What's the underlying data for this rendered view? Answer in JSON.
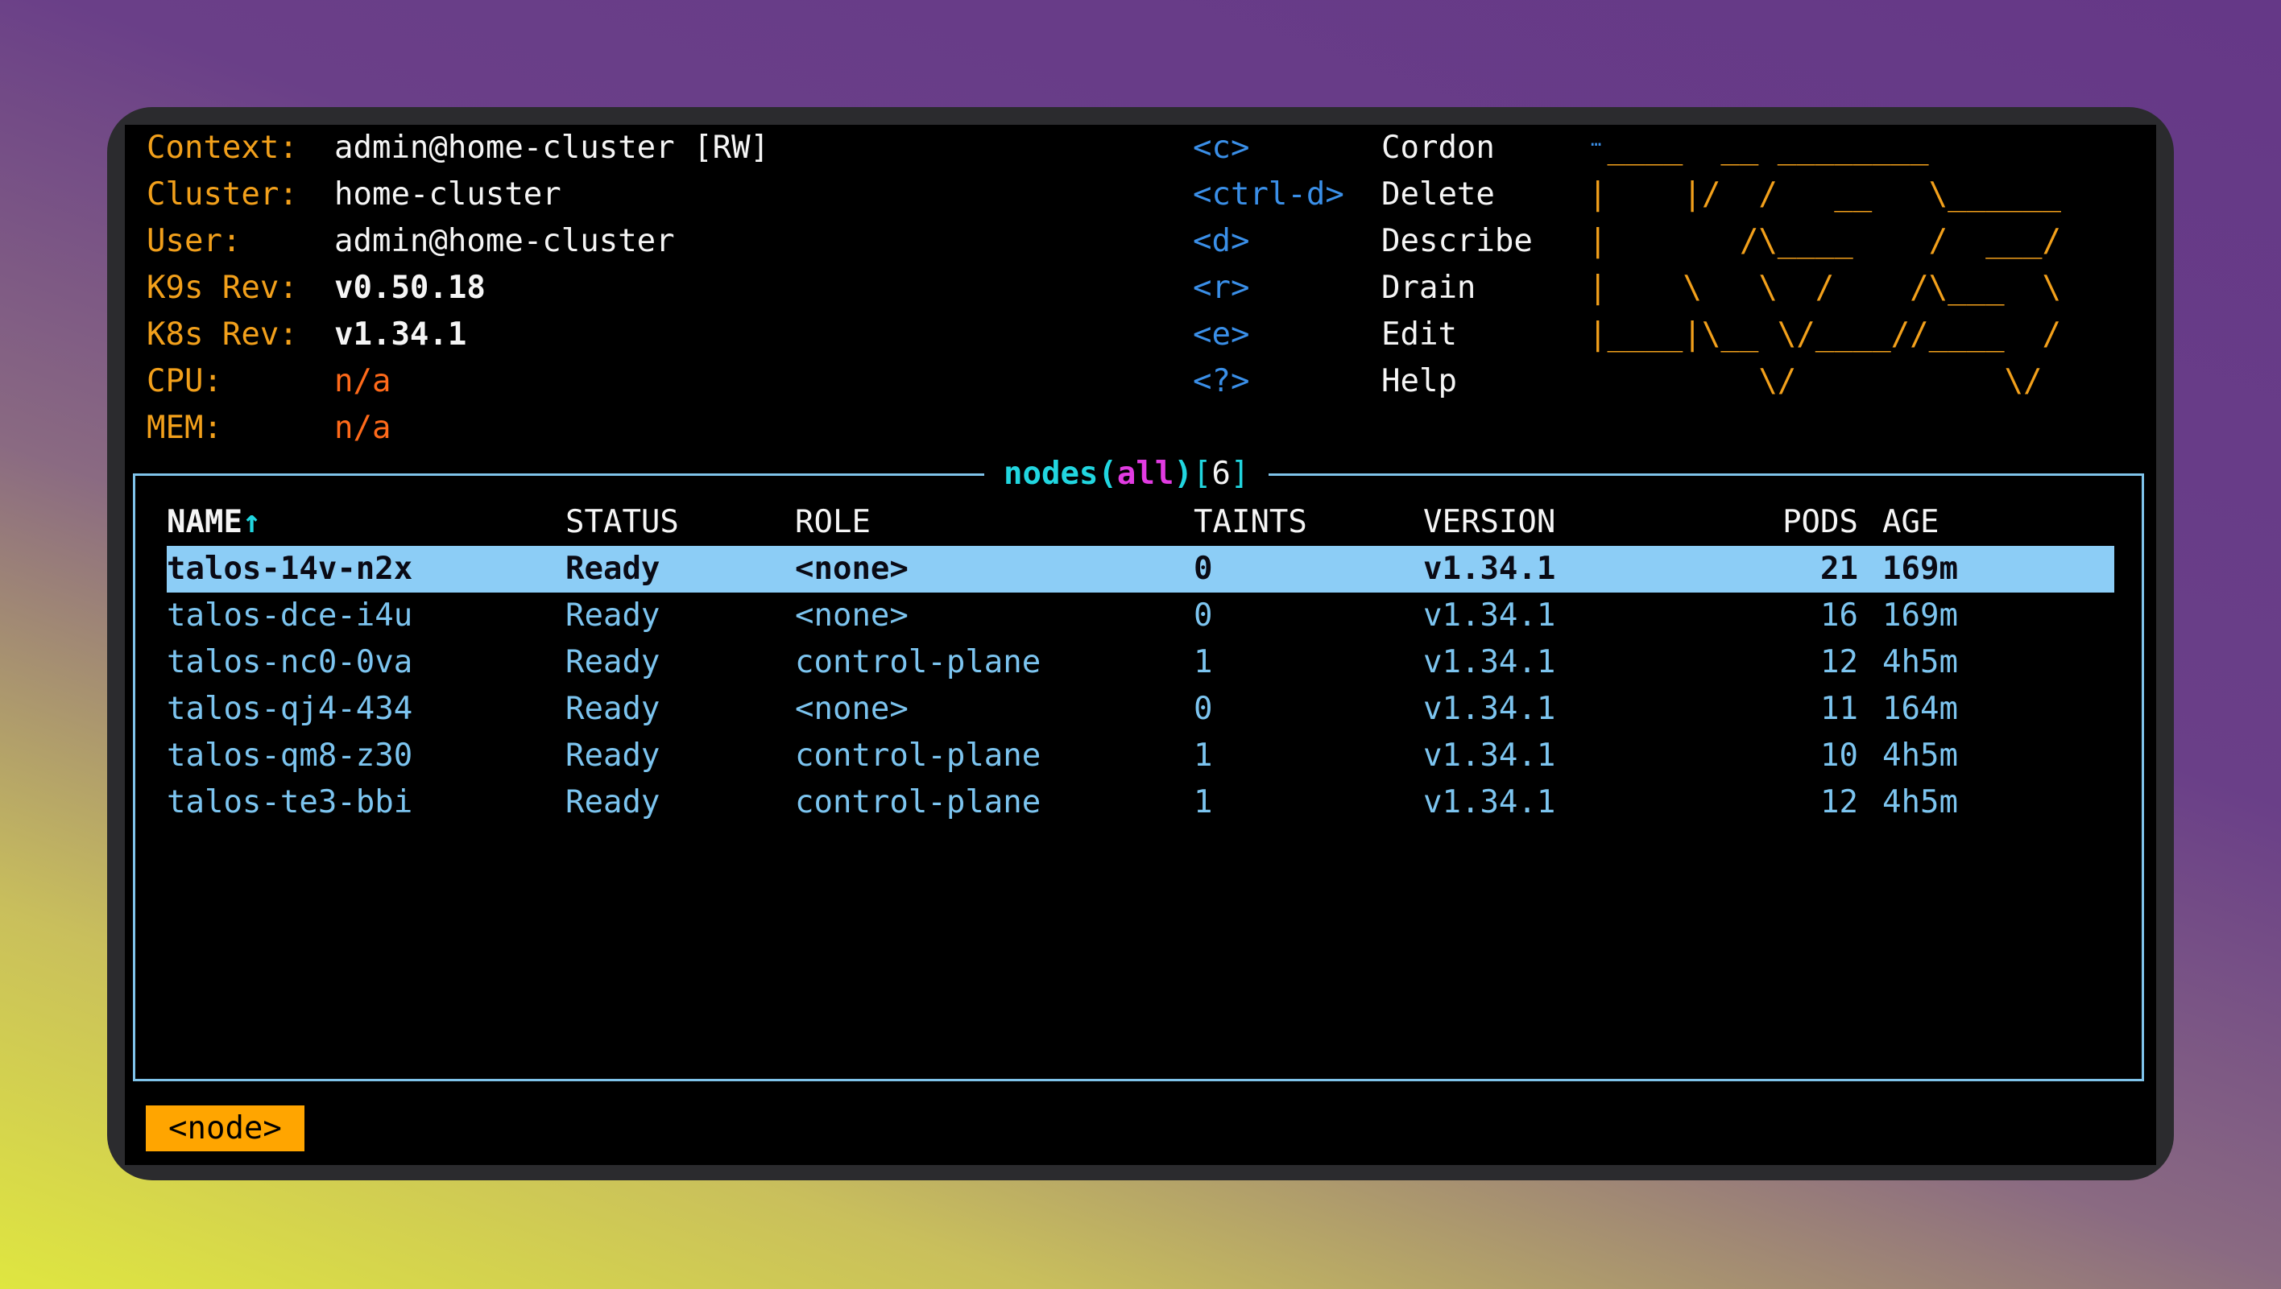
{
  "info": [
    {
      "label": "Context:",
      "value": "admin@home-cluster [RW]"
    },
    {
      "label": "Cluster:",
      "value": "home-cluster"
    },
    {
      "label": "User:",
      "value": "admin@home-cluster"
    },
    {
      "label": "K9s Rev:",
      "value": "v0.50.18"
    },
    {
      "label": "K8s Rev:",
      "value": "v1.34.1"
    },
    {
      "label": "CPU:",
      "value": "n/a"
    },
    {
      "label": "MEM:",
      "value": "n/a"
    }
  ],
  "hotkeys": [
    {
      "key": "<c>",
      "desc": "Cordon"
    },
    {
      "key": "<ctrl-d>",
      "desc": "Delete"
    },
    {
      "key": "<d>",
      "desc": "Describe"
    },
    {
      "key": "<r>",
      "desc": "Drain"
    },
    {
      "key": "<e>",
      "desc": "Edit"
    },
    {
      "key": "<?>",
      "desc": "Help"
    }
  ],
  "logo_ellipsis": "…",
  "logo_lines": [
    " ____  __ ________       ",
    "|    |/  /   __   \\______",
    "|       /\\____    /  ___/",
    "|    \\   \\  /    /\\___  \\",
    "|____|\\__ \\/____//____  /",
    "         \\/           \\/ "
  ],
  "panel": {
    "resource": "nodes",
    "open_paren": "(",
    "namespace": "all",
    "close_paren": ")",
    "count_open": "[",
    "count": "6",
    "count_close": "]"
  },
  "table": {
    "headers": {
      "name": "NAME",
      "sort_indicator": "↑",
      "status": "STATUS",
      "role": "ROLE",
      "taints": "TAINTS",
      "version": "VERSION",
      "pods": "PODS",
      "age": "AGE"
    },
    "rows": [
      {
        "name": "talos-14v-n2x",
        "status": "Ready",
        "role": "<none>",
        "taints": "0",
        "version": "v1.34.1",
        "pods": "21",
        "age": "169m"
      },
      {
        "name": "talos-dce-i4u",
        "status": "Ready",
        "role": "<none>",
        "taints": "0",
        "version": "v1.34.1",
        "pods": "16",
        "age": "169m"
      },
      {
        "name": "talos-nc0-0va",
        "status": "Ready",
        "role": "control-plane",
        "taints": "1",
        "version": "v1.34.1",
        "pods": "12",
        "age": "4h5m"
      },
      {
        "name": "talos-qj4-434",
        "status": "Ready",
        "role": "<none>",
        "taints": "0",
        "version": "v1.34.1",
        "pods": "11",
        "age": "164m"
      },
      {
        "name": "talos-qm8-z30",
        "status": "Ready",
        "role": "control-plane",
        "taints": "1",
        "version": "v1.34.1",
        "pods": "10",
        "age": "4h5m"
      },
      {
        "name": "talos-te3-bbi",
        "status": "Ready",
        "role": "control-plane",
        "taints": "1",
        "version": "v1.34.1",
        "pods": "12",
        "age": "4h5m"
      }
    ]
  },
  "breadcrumb": "<node>"
}
